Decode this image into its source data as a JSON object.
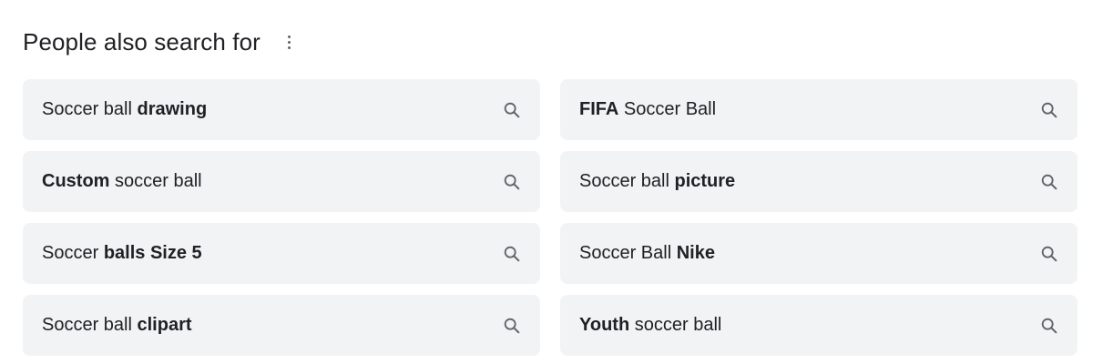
{
  "section": {
    "title": "People also search for",
    "more_icon": "more-vert-icon"
  },
  "suggestions": [
    {
      "parts": [
        {
          "text": "Soccer ball ",
          "bold": false
        },
        {
          "text": "drawing",
          "bold": true
        }
      ],
      "icon": "search-icon"
    },
    {
      "parts": [
        {
          "text": "FIFA",
          "bold": true
        },
        {
          "text": " Soccer Ball",
          "bold": false
        }
      ],
      "icon": "search-icon"
    },
    {
      "parts": [
        {
          "text": "Custom",
          "bold": true
        },
        {
          "text": " soccer ball",
          "bold": false
        }
      ],
      "icon": "search-icon"
    },
    {
      "parts": [
        {
          "text": "Soccer ball ",
          "bold": false
        },
        {
          "text": "picture",
          "bold": true
        }
      ],
      "icon": "search-icon"
    },
    {
      "parts": [
        {
          "text": "Soccer ",
          "bold": false
        },
        {
          "text": "balls Size 5",
          "bold": true
        }
      ],
      "icon": "search-icon"
    },
    {
      "parts": [
        {
          "text": "Soccer Ball ",
          "bold": false
        },
        {
          "text": "Nike",
          "bold": true
        }
      ],
      "icon": "search-icon"
    },
    {
      "parts": [
        {
          "text": "Soccer ball ",
          "bold": false
        },
        {
          "text": "clipart",
          "bold": true
        }
      ],
      "icon": "search-icon"
    },
    {
      "parts": [
        {
          "text": "Youth",
          "bold": true
        },
        {
          "text": " soccer ball",
          "bold": false
        }
      ],
      "icon": "search-icon"
    }
  ],
  "colors": {
    "chip_background": "#f1f3f4",
    "text": "#202124",
    "icon": "#5f6368"
  }
}
